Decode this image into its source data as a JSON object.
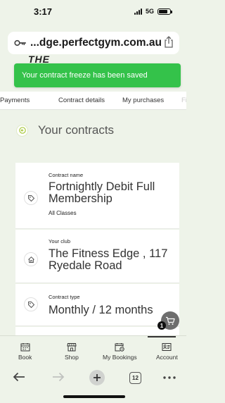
{
  "status_bar": {
    "time": "3:17",
    "network": "5G",
    "battery_level": 0.8
  },
  "url_bar": {
    "url": "...dge.perfectgym.com.au",
    "lock_icon": "key-icon",
    "share_icon": "share-icon"
  },
  "brand": {
    "logo_text": "THE"
  },
  "toast": {
    "message": "Your contract freeze has been saved",
    "color": "#34c24a"
  },
  "tabs": [
    {
      "label": "Payments"
    },
    {
      "label": "Contract details"
    },
    {
      "label": "My purchases"
    },
    {
      "label": "Fi"
    }
  ],
  "section": {
    "title": "Your contracts",
    "back_icon": "arrow-left-circle-icon",
    "accent": "#a8c83c"
  },
  "contract": {
    "name_label": "Contract name",
    "name_value": "Fortnightly Debit Full Membership",
    "name_sub": "All Classes",
    "club_label": "Your club",
    "club_value": "The Fitness Edge , 117 Ryedale Road",
    "type_label": "Contract type",
    "type_value": "Monthly / 12 months"
  },
  "cart": {
    "count": "1",
    "icon": "cart-icon"
  },
  "app_nav": [
    {
      "label": "Book",
      "icon": "calendar-icon"
    },
    {
      "label": "Shop",
      "icon": "store-icon"
    },
    {
      "label": "My Bookings",
      "icon": "calendar-clock-icon"
    },
    {
      "label": "Account",
      "icon": "id-card-icon"
    }
  ],
  "browser_toolbar": {
    "tab_count": "12",
    "back_icon": "arrow-left-icon",
    "forward_icon": "arrow-right-icon",
    "new_tab_icon": "plus-icon",
    "more_icon": "ellipsis-icon"
  }
}
